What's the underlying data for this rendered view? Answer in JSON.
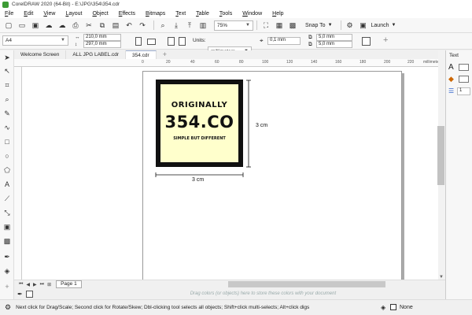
{
  "window": {
    "title": "CorelDRAW 2020 (64-Bit) - E:\\JPG\\354\\354.cdr"
  },
  "menu": [
    "File",
    "Edit",
    "View",
    "Layout",
    "Object",
    "Effects",
    "Bitmaps",
    "Text",
    "Table",
    "Tools",
    "Window",
    "Help"
  ],
  "toolbar": {
    "zoom_value": "75%",
    "snap_label": "Snap To",
    "launch_label": "Launch"
  },
  "propbar": {
    "page_size": "A4",
    "width_value": "210,0 mm",
    "height_value": "297,0 mm",
    "units_label": "Units:",
    "units_value": "millimeters",
    "nudge_value": "0,1 mm",
    "dup_x": "5,0 mm",
    "dup_y": "5,0 mm"
  },
  "doc_tabs": [
    {
      "label": "Welcome Screen"
    },
    {
      "label": "ALL JPG LABEL.cdr"
    },
    {
      "label": "354.cdr"
    }
  ],
  "ruler": {
    "ticks": [
      "0",
      "20",
      "40",
      "60",
      "80",
      "100",
      "120",
      "140",
      "160",
      "180",
      "200",
      "220"
    ],
    "unit": "millimeters"
  },
  "artwork": {
    "line1": "ORIGINALLY",
    "line2": "354.CO",
    "line3": "SIMPLE BUT DIFFERENT",
    "dim_vertical": "3 cm",
    "dim_horizontal": "3 cm",
    "bg_color": "#ffffcc",
    "border_color": "#111111"
  },
  "page_nav": {
    "page_tab": "Page 1"
  },
  "palette": {
    "hint": "Drag colors (or objects) here to store these colors with your document"
  },
  "status": {
    "message": "Next click for Drag/Scale; Second click for Rotate/Skew; Dbl-clicking tool selects all objects; Shift+click multi-selects; Alt+click digs",
    "fill_label": "None"
  },
  "docker": {
    "header": "Text",
    "field_value": "1"
  }
}
